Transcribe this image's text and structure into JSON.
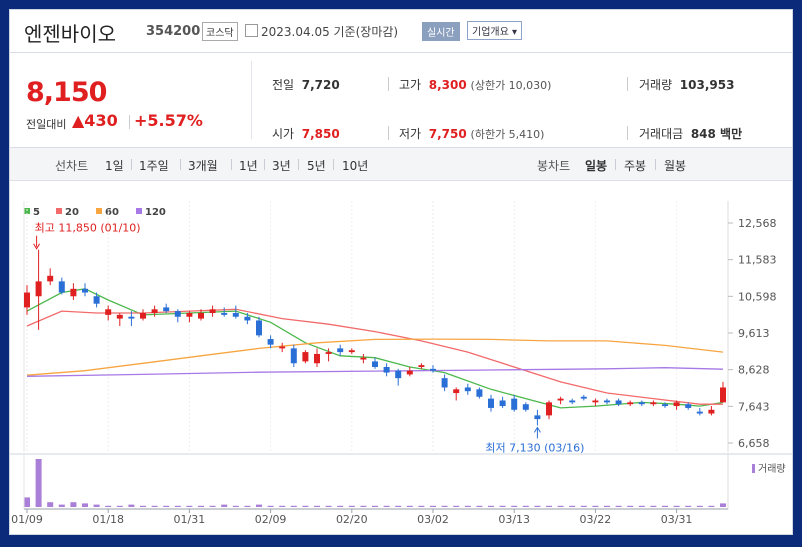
{
  "header": {
    "name": "엔젠바이오",
    "code": "354200",
    "market": "코스닥",
    "date_text": "2023.04.05 기준(장마감)",
    "realtime_label": "실시간",
    "company_label": "기업개요 ▾"
  },
  "quote": {
    "price": "8,150",
    "vs_label": "전일대비",
    "change": "▲430",
    "change_pct": "+5.57%",
    "prev_label": "전일",
    "prev_value": "7,720",
    "open_label": "시가",
    "open_value": "7,850",
    "high_label": "고가",
    "high_value": "8,300",
    "upper_limit": "(상한가 10,030)",
    "low_label": "저가",
    "low_value": "7,750",
    "lower_limit": "(하한가 5,410)",
    "volume_label": "거래량",
    "volume_value": "103,953",
    "amount_label": "거래대금",
    "amount_value": "848 백만"
  },
  "periods": {
    "line_label": "선차트",
    "line_items": [
      "1일",
      "1주일",
      "3개월",
      "1년",
      "3년",
      "5년",
      "10년"
    ],
    "candle_label": "봉차트",
    "candle_items": [
      "일봉",
      "주봉",
      "월봉"
    ],
    "active_candle": "일봉",
    "active_color": "#1f5fd6"
  },
  "chart_data": {
    "type": "candlestick",
    "legend": [
      {
        "label": "5",
        "color": "#4cb84c"
      },
      {
        "label": "20",
        "color": "#f26a6a"
      },
      {
        "label": "60",
        "color": "#f7a540"
      },
      {
        "label": "120",
        "color": "#a779e6"
      }
    ],
    "y_ticks": [
      "12,568",
      "11,583",
      "10,598",
      "9,613",
      "8,628",
      "7,643",
      "6,658"
    ],
    "y_tick_values": [
      12568,
      11583,
      10598,
      9613,
      8628,
      7643,
      6658
    ],
    "x_ticks": [
      "01/09",
      "01/18",
      "01/31",
      "02/09",
      "02/20",
      "03/02",
      "03/13",
      "03/22",
      "03/31"
    ],
    "x_tick_index": [
      0,
      7,
      14,
      21,
      28,
      35,
      42,
      49,
      56
    ],
    "up_color": "#e02020",
    "down_color": "#2a6fd6",
    "candles": [
      {
        "o": 10300,
        "h": 10900,
        "l": 10100,
        "c": 10700
      },
      {
        "o": 10600,
        "h": 11850,
        "l": 9700,
        "c": 11000
      },
      {
        "o": 11000,
        "h": 11350,
        "l": 10900,
        "c": 11150
      },
      {
        "o": 11000,
        "h": 11100,
        "l": 10650,
        "c": 10700
      },
      {
        "o": 10600,
        "h": 10950,
        "l": 10500,
        "c": 10800
      },
      {
        "o": 10800,
        "h": 10950,
        "l": 10600,
        "c": 10700
      },
      {
        "o": 10600,
        "h": 10700,
        "l": 10300,
        "c": 10400
      },
      {
        "o": 10100,
        "h": 10350,
        "l": 9950,
        "c": 10250
      },
      {
        "o": 10000,
        "h": 10150,
        "l": 9800,
        "c": 10100
      },
      {
        "o": 10050,
        "h": 10200,
        "l": 9800,
        "c": 10000
      },
      {
        "o": 10000,
        "h": 10250,
        "l": 9950,
        "c": 10150
      },
      {
        "o": 10150,
        "h": 10350,
        "l": 10050,
        "c": 10250
      },
      {
        "o": 10300,
        "h": 10400,
        "l": 10150,
        "c": 10200
      },
      {
        "o": 10200,
        "h": 10250,
        "l": 9900,
        "c": 10050
      },
      {
        "o": 10050,
        "h": 10200,
        "l": 9900,
        "c": 10150
      },
      {
        "o": 10000,
        "h": 10250,
        "l": 9950,
        "c": 10150
      },
      {
        "o": 10150,
        "h": 10350,
        "l": 10050,
        "c": 10250
      },
      {
        "o": 10150,
        "h": 10300,
        "l": 10050,
        "c": 10100
      },
      {
        "o": 10150,
        "h": 10350,
        "l": 10000,
        "c": 10050
      },
      {
        "o": 10050,
        "h": 10150,
        "l": 9850,
        "c": 9950
      },
      {
        "o": 9950,
        "h": 10050,
        "l": 9500,
        "c": 9550
      },
      {
        "o": 9450,
        "h": 9550,
        "l": 9200,
        "c": 9300
      },
      {
        "o": 9200,
        "h": 9350,
        "l": 9100,
        "c": 9250
      },
      {
        "o": 9200,
        "h": 9300,
        "l": 8700,
        "c": 8800
      },
      {
        "o": 8850,
        "h": 9150,
        "l": 8800,
        "c": 9100
      },
      {
        "o": 8800,
        "h": 9200,
        "l": 8700,
        "c": 9050
      },
      {
        "o": 9050,
        "h": 9200,
        "l": 8850,
        "c": 9100
      },
      {
        "o": 9200,
        "h": 9300,
        "l": 9000,
        "c": 9100
      },
      {
        "o": 9100,
        "h": 9200,
        "l": 9050,
        "c": 9150
      },
      {
        "o": 8900,
        "h": 9050,
        "l": 8800,
        "c": 8950
      },
      {
        "o": 8850,
        "h": 8950,
        "l": 8650,
        "c": 8700
      },
      {
        "o": 8700,
        "h": 8800,
        "l": 8450,
        "c": 8550
      },
      {
        "o": 8600,
        "h": 8650,
        "l": 8200,
        "c": 8400
      },
      {
        "o": 8500,
        "h": 8700,
        "l": 8450,
        "c": 8600
      },
      {
        "o": 8700,
        "h": 8800,
        "l": 8650,
        "c": 8750
      },
      {
        "o": 8650,
        "h": 8750,
        "l": 8550,
        "c": 8600
      },
      {
        "o": 8400,
        "h": 8500,
        "l": 8050,
        "c": 8150
      },
      {
        "o": 8000,
        "h": 8150,
        "l": 7800,
        "c": 8100
      },
      {
        "o": 8150,
        "h": 8250,
        "l": 7950,
        "c": 8050
      },
      {
        "o": 8100,
        "h": 8150,
        "l": 7850,
        "c": 7900
      },
      {
        "o": 7850,
        "h": 7950,
        "l": 7500,
        "c": 7600
      },
      {
        "o": 7800,
        "h": 7900,
        "l": 7600,
        "c": 7650
      },
      {
        "o": 7850,
        "h": 7950,
        "l": 7500,
        "c": 7550
      },
      {
        "o": 7700,
        "h": 7750,
        "l": 7500,
        "c": 7550
      },
      {
        "o": 7400,
        "h": 7550,
        "l": 7130,
        "c": 7300
      },
      {
        "o": 7400,
        "h": 7800,
        "l": 7300,
        "c": 7750
      },
      {
        "o": 7800,
        "h": 7900,
        "l": 7700,
        "c": 7850
      },
      {
        "o": 7800,
        "h": 7850,
        "l": 7700,
        "c": 7750
      },
      {
        "o": 7900,
        "h": 7950,
        "l": 7800,
        "c": 7850
      },
      {
        "o": 7750,
        "h": 7850,
        "l": 7650,
        "c": 7800
      },
      {
        "o": 7800,
        "h": 7850,
        "l": 7700,
        "c": 7750
      },
      {
        "o": 7800,
        "h": 7850,
        "l": 7650,
        "c": 7700
      },
      {
        "o": 7700,
        "h": 7800,
        "l": 7650,
        "c": 7750
      },
      {
        "o": 7750,
        "h": 7800,
        "l": 7650,
        "c": 7700
      },
      {
        "o": 7700,
        "h": 7800,
        "l": 7650,
        "c": 7750
      },
      {
        "o": 7700,
        "h": 7750,
        "l": 7600,
        "c": 7650
      },
      {
        "o": 7650,
        "h": 7800,
        "l": 7550,
        "c": 7750
      },
      {
        "o": 7700,
        "h": 7750,
        "l": 7550,
        "c": 7600
      },
      {
        "o": 7500,
        "h": 7600,
        "l": 7400,
        "c": 7450
      },
      {
        "o": 7450,
        "h": 7650,
        "l": 7400,
        "c": 7550
      },
      {
        "o": 7750,
        "h": 8300,
        "l": 7750,
        "c": 8150
      }
    ],
    "ma": [
      {
        "period": "5",
        "points": [
          [
            0,
            10200
          ],
          [
            3,
            10700
          ],
          [
            5,
            10800
          ],
          [
            7,
            10500
          ],
          [
            10,
            10100
          ],
          [
            14,
            10150
          ],
          [
            18,
            10200
          ],
          [
            21,
            9900
          ],
          [
            24,
            9350
          ],
          [
            27,
            9000
          ],
          [
            30,
            8950
          ],
          [
            33,
            8700
          ],
          [
            36,
            8550
          ],
          [
            40,
            8100
          ],
          [
            43,
            7850
          ],
          [
            46,
            7600
          ],
          [
            49,
            7650
          ],
          [
            53,
            7750
          ],
          [
            56,
            7700
          ],
          [
            58,
            7650
          ],
          [
            60,
            7750
          ]
        ]
      },
      {
        "period": "20",
        "points": [
          [
            0,
            9800
          ],
          [
            3,
            10200
          ],
          [
            6,
            10150
          ],
          [
            10,
            10150
          ],
          [
            14,
            10200
          ],
          [
            18,
            10250
          ],
          [
            22,
            10000
          ],
          [
            26,
            9850
          ],
          [
            30,
            9650
          ],
          [
            34,
            9400
          ],
          [
            38,
            9100
          ],
          [
            42,
            8700
          ],
          [
            46,
            8300
          ],
          [
            50,
            8000
          ],
          [
            54,
            7850
          ],
          [
            58,
            7700
          ],
          [
            60,
            7700
          ]
        ]
      },
      {
        "period": "60",
        "points": [
          [
            0,
            8480
          ],
          [
            5,
            8600
          ],
          [
            10,
            8800
          ],
          [
            15,
            9000
          ],
          [
            20,
            9200
          ],
          [
            25,
            9350
          ],
          [
            30,
            9440
          ],
          [
            35,
            9450
          ],
          [
            40,
            9440
          ],
          [
            45,
            9400
          ],
          [
            50,
            9400
          ],
          [
            55,
            9280
          ],
          [
            60,
            9100
          ]
        ]
      },
      {
        "period": "120",
        "points": [
          [
            0,
            8450
          ],
          [
            10,
            8500
          ],
          [
            20,
            8560
          ],
          [
            30,
            8590
          ],
          [
            40,
            8620
          ],
          [
            50,
            8650
          ],
          [
            55,
            8680
          ],
          [
            60,
            8640
          ]
        ]
      }
    ],
    "annotations": {
      "high": {
        "text": "최고 11,850 (01/10)",
        "index": 1,
        "value": 11850
      },
      "low": {
        "text": "최저 7,130 (03/16)",
        "index": 44,
        "value": 7130
      }
    },
    "volume_label": "거래량",
    "volume_color": "#a97fd8",
    "volumes": [
      8,
      40,
      4,
      2,
      4,
      3,
      2,
      1,
      1,
      2,
      1,
      1,
      1,
      1,
      1,
      1,
      1,
      2,
      1,
      1,
      2,
      1,
      1,
      1,
      1,
      1,
      1,
      1,
      1,
      1,
      1,
      1,
      1,
      1,
      1,
      1,
      1,
      1,
      1,
      1,
      1,
      1,
      1,
      1,
      1,
      1,
      1,
      1,
      1,
      1,
      1,
      1,
      1,
      1,
      1,
      1,
      1,
      1,
      1,
      1,
      3
    ]
  }
}
